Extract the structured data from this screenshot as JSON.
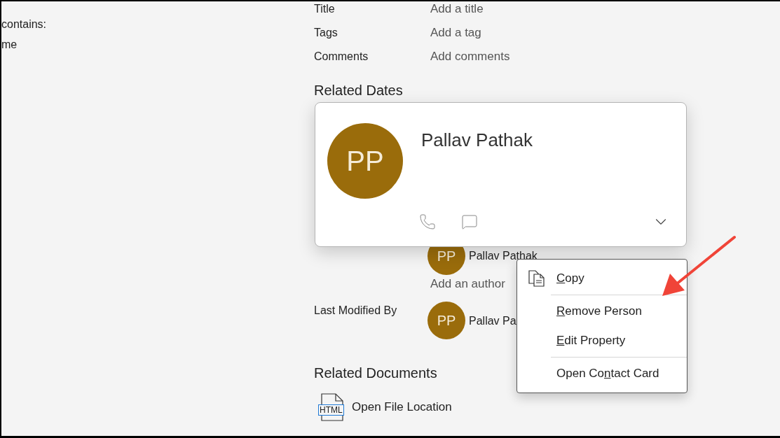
{
  "left_pane": {
    "lines": [
      "contains:",
      "me"
    ]
  },
  "properties": [
    {
      "label": "Title",
      "placeholder": "Add a title"
    },
    {
      "label": "Tags",
      "placeholder": "Add a tag"
    },
    {
      "label": "Comments",
      "placeholder": "Add comments"
    }
  ],
  "related_dates": {
    "heading": "Related Dates"
  },
  "authors": {
    "people": [
      {
        "initials": "PP",
        "name": "Pallav Pathak"
      }
    ],
    "add_placeholder": "Add an author"
  },
  "last_modified_by": {
    "label": "Last Modified By",
    "initials": "PP",
    "name": "Pallav Pa"
  },
  "related_documents": {
    "heading": "Related Documents",
    "items": [
      {
        "file_type": "HTML",
        "label": "Open File Location"
      }
    ]
  },
  "contact_card": {
    "initials": "PP",
    "name": "Pallav Pathak"
  },
  "context_menu": {
    "items": [
      {
        "kind": "copy_command",
        "key": "C",
        "after": "opy"
      },
      {
        "kind": "separator"
      },
      {
        "kind": "command",
        "key": "R",
        "after": "emove Person"
      },
      {
        "kind": "command",
        "key": "E",
        "after": "dit Property"
      },
      {
        "kind": "separator"
      },
      {
        "kind": "command",
        "before": "Open Co",
        "key": "n",
        "after": "tact Card"
      }
    ]
  }
}
